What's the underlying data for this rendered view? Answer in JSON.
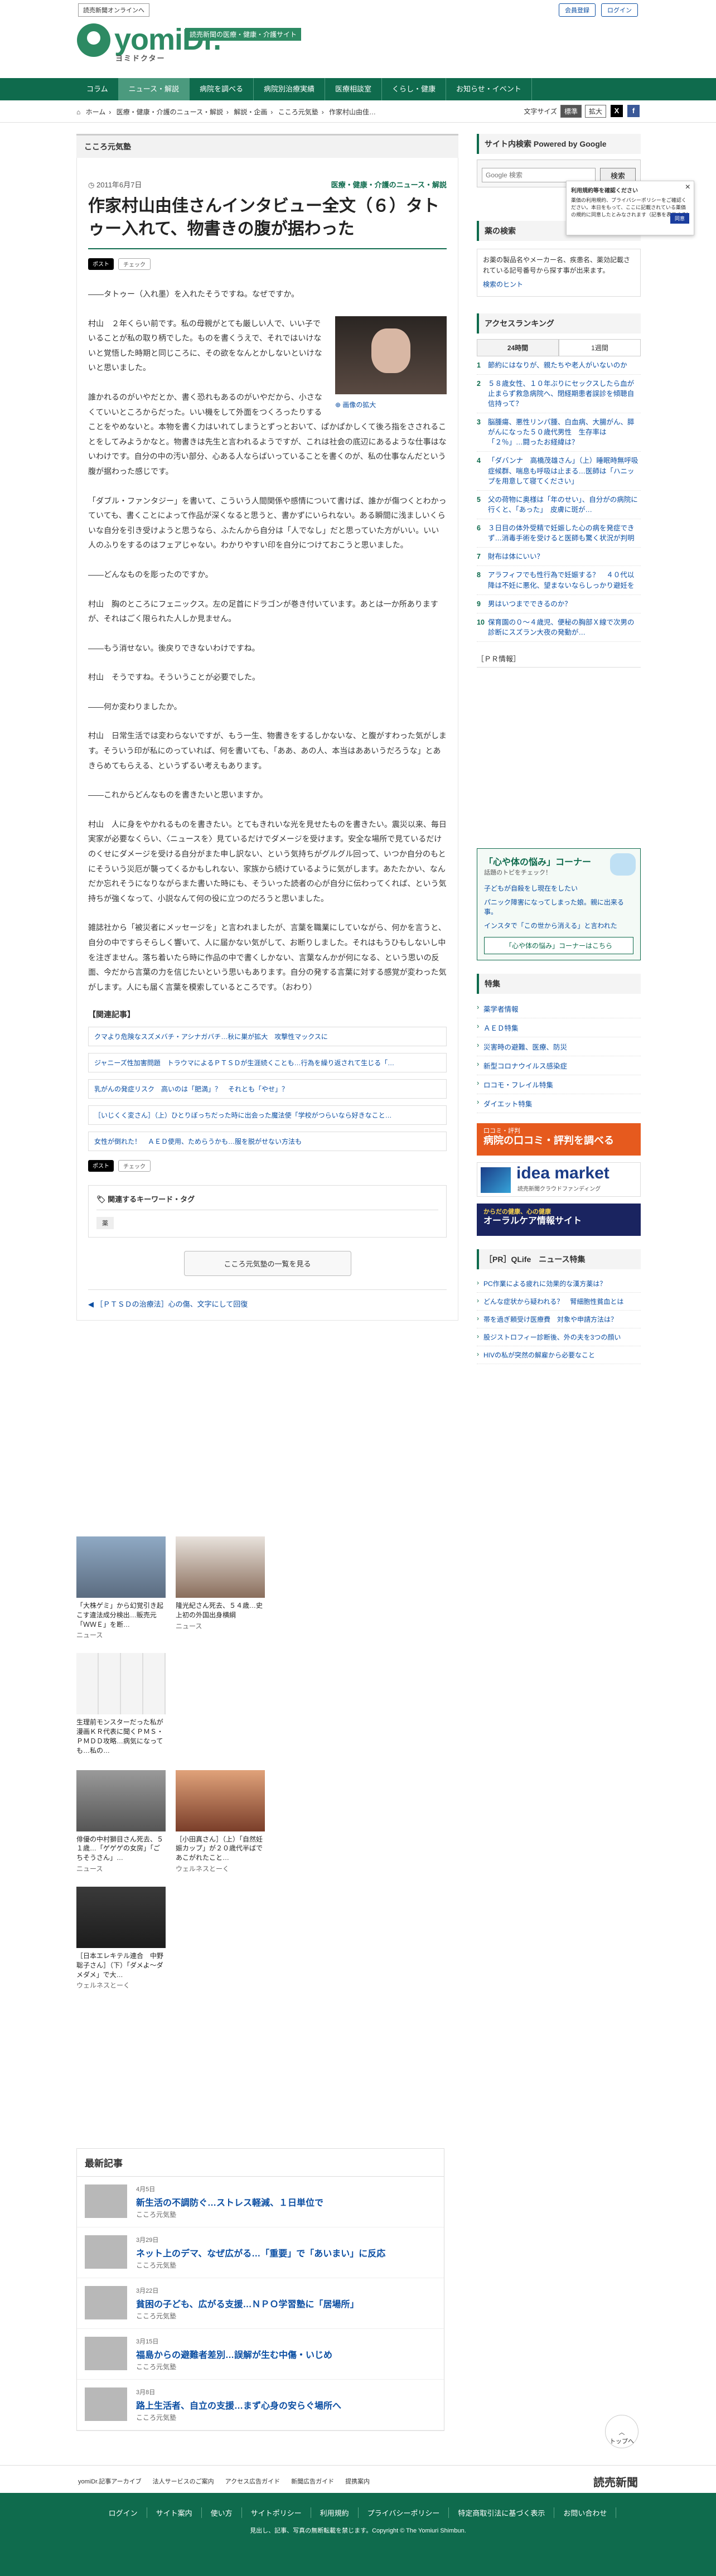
{
  "topbar": {
    "yol": "読売新聞オンラインへ",
    "member": "会員登録",
    "login": "ログイン"
  },
  "logo": {
    "name": "yomiDr.",
    "kana": "ヨミドクター",
    "tag": "読売新聞の医療・健康・介護サイト"
  },
  "gnav": [
    "コラム",
    "ニュース・解説",
    "病院を調べる",
    "病院別治療実績",
    "医療相談室",
    "くらし・健康",
    "お知らせ・イベント"
  ],
  "gnav_active": "ニュース・解説",
  "breadcrumbs": [
    "ホーム",
    "医療・健康・介護のニュース・解説",
    "解説・企画",
    "こころ元気塾",
    "作家村山由佳…"
  ],
  "fontsize": {
    "label": "文字サイズ",
    "std": "標準",
    "big": "拡大"
  },
  "article": {
    "section": "こころ元気塾",
    "date": "2011年6月7日",
    "category": "医療・健康・介護のニュース・解説",
    "title": "作家村山由佳さんインタビュー全文（６）タトゥー入れて、物書きの腹が据わった",
    "share_x": "ポスト",
    "share_check": "チェック",
    "photo_caption": "画像の拡大",
    "paragraphs": [
      "――タトゥー（入れ墨）を入れたそうですね。なぜですか。",
      "村山　２年くらい前です。私の母親がとても厳しい人で、いい子でいることが私の取り柄でした。ものを書くうえで、それではいけないと覚悟した時期と同じころに、その欲をなんとかしないといけないと思いました。",
      "誰かれるのがいやだとか、書く恐れもあるのがいやだから、小さなくていいところからだった。いい機をして外面をつくろったりすることをやめないと。本物を書く力はいれてしまうとずっとおいて、ぱかぱかしくて後ろ指をさされることをしてみようかなと。物書きは先生と言われるようですが、これは社会の底辺にあるような仕事はないわけです。自分の中の汚い部分、心ある人ならばいっていることを書くのが、私の仕事なんだという腹が据わった感じです。",
      "「ダブル・ファンタジー」を書いて、こういう人間関係や感情について書けば、誰かが傷つくとわかっていても、書くことによって作品が深くなると思うと、書かずにいられない。ある瞬間に浅ましいくらいな自分を引き受けようと思うなら、ふたんから自分は「人でなし」だと思っていた方がいい。いい人のふりをするのはフェアじゃない。わかりやすい印を自分につけておこうと思いました。",
      "――どんなものを彫ったのですか。",
      "村山　胸のところにフェニックス。左の足首にドラゴンが巻き付いています。あとは一か所ありますが、それはごく限られた人しか見ません。",
      "――もう消せない。後戻りできないわけですね。",
      "村山　そうですね。そういうことが必要でした。",
      "――何か変わりましたか。",
      "村山　日常生活では変わらないですが、もう一生、物書きをするしかないな、と腹がすわった気がします。そういう印が私にのっていれば、何を書いても、「ああ、あの人、本当はああいうだろうな」とあきらめてもらえる、というずるい考えもあります。",
      "――これからどんなものを書きたいと思いますか。",
      "村山　人に身をやかれるものを書きたい。とてもきれいな光を見せたものを書きたい。震災以来、毎日実家が必要なくらい、〈ニュースを〉見ているだけでダメージを受けます。安全な場所で見ているだけのくせにダメージを受ける自分がまた申し訳ない、という気持ちがグルグル回って、いつか自分のもとにそういう災厄が襲ってくるかもしれない、家族から続けているように気がします。あたたかい、なんだか忘れそうになりながらまた書いた時にも、そういった読者の心が自分に伝わってくれば、という気持ちが強くなって、小説なんて何の役に立つのだろうと思いました。",
      "雑誌社から「被災者にメッセージを」と言われましたが、言葉を職業にしていながら、何かを言うと、自分の中ですらそらしく響いて、人に届かない気がして、お断りしました。それはもうひもしないし中を注ぎません。落ち着いたら時に作品の中で書くしかない、言葉なんかが何になる、という思いの反面、今だから言葉の力を信じたいという思いもあります。自分の発する言葉に対する感覚が変わった気がします。人にも届く言葉を模索しているところです。（おわり）"
    ]
  },
  "related": {
    "heading": "【関連記事】",
    "items": [
      "クマより危険なスズメバチ・アシナガバチ…秋に巣が拡大　攻撃性マックスに",
      "ジャニーズ性加害問題　トラウマによるＰＴＳＤが生涯続くことも…行為を繰り返されて生じる「…",
      "乳がんの発症リスク　高いのは「肥満」？　それとも「やせ」？",
      "［いじくく変さん］（上）ひとりぼっちだった時に出会った魔法使「学校がつらいなら好きなこと…",
      "女性が倒れた！　ＡＥＤ使用、ためらうかも…服を脱がせない方法も"
    ]
  },
  "keywords": {
    "heading": "関連するキーワード・タグ",
    "tags": [
      "薬"
    ]
  },
  "more_button": "こころ元気塾の一覧を見る",
  "prev_link": "［ＰＴＳＤの治療法］心の傷、文字にして回復",
  "sidebar": {
    "search_heading": "サイト内検索 Powered by Google",
    "search_placeholder": "Google 検索",
    "search_button": "検索",
    "popup_title": "利用規約等を確認ください",
    "popup_body": "薬価の利用規約、プライバシーポリシーをご確認ください。本日をもって、ここに記載されている薬価の規約に同意したとみなされます（記事を表示する）",
    "popup_ok": "同意",
    "intro_heading": "薬の検索",
    "intro_text": "お薬の製品名やメーカー名、疾患名、薬効記載されている記号番号から探す事が出来ます。",
    "intro_link": "検索のヒント",
    "ranking_heading": "アクセスランキング",
    "ranking_tabs": [
      "24時間",
      "1週間"
    ],
    "ranking": [
      "節約にはなりが、親たちや老人がいないのか",
      "５８歳女性、１０年ぶりにセックスしたら血が止まらず救急病院へ、閉経期患者誤診を傾聴自信持って？",
      "脳腫瘍、悪性リンパ腫、白血病、大腸がん、膵がんになった５０歳代男性　生存率は「２％」…闘ったお経緯は？",
      "「ダバンナ　高橋茂雄さん」（上）睡眠時無呼吸症候群、喘息も呼吸は止まる…医師は「ハニップを用意して寝てください」",
      "父の荷物に奥様は「年のせい」、自分がの病院に行くと、「あった」　皮膚に斑が…",
      "３日目の体外受精で妊娠した心の病を発症できず…消毒手術を受けると医師も驚く状況が判明",
      "財布は体にいい？",
      "アラフィフでも性行為で妊娠する？　４０代以降は不妊に悪化、望まないならしっかり避妊を",
      "男はいつまでできるのか？",
      "保育園の０～４歳児、便秘の胸部Ｘ線で次男の診断にスズラン大夜の発動が…"
    ],
    "pr_heading": "［ＰＲ情報］",
    "kokoro_title": "「心や体の悩み」コーナー",
    "kokoro_sub": "話題のトピをチェック！",
    "kokoro_items": [
      "子どもが自殺をし現在をしたい",
      "パニック障害になってしまった娘。親に出来る事。",
      "インスタで「この世から消える」と言われた"
    ],
    "kokoro_cta": "「心や体の悩み」コーナーはこちら",
    "tokushu_heading": "特集",
    "tokushu": [
      "薬学者情報",
      "ＡＥＤ特集",
      "災害時の避難、医療、防災",
      "新型コロナウイルス感染症",
      "ロコモ・フレイル特集",
      "ダイエット特集"
    ],
    "banner1_small": "口コミ・評判",
    "banner1": "病院の口コミ・評判を調べる",
    "banner2": "idea market",
    "banner2_sub": "読売新聞クラウドファンディング",
    "banner3_small": "からだの健康、心の健康",
    "banner3": "オーラルケア情報サイト",
    "qlife_heading": "［PR］QLife　ニュース特集",
    "qlife": [
      "PC作業による疲れに効果的な漢方薬は？",
      "どんな症状から疑われる？　腎細胞性貧血とは",
      "帯を過ぎ頼受け医療費　対象や申請方法は？",
      "股ジストロフィー診断後、外の夫を3つの顔い",
      "HIVの私が突然の解雇から必要なこと"
    ]
  },
  "cards": [
    {
      "title": "「大株ゲミ」から幻覚引き起こす違法成分検出…販売元「ＷＷＥ」を断…",
      "src": "ニュース"
    },
    {
      "title": "隆光紀さん死去、５４歳…史上初の外国出身横綱",
      "src": "ニュース"
    },
    {
      "title": "生理前モンスターだった私が漫画ＫＲ代表に聞くＰＭＳ・ＰＭＤＤ攻略…病気になっても…私の…",
      "src": ""
    },
    {
      "title": "俳優の中村獅目さん死去、５１歳…「ゲゲゲの女房」「ごちそうさん」…",
      "src": "ニュース"
    },
    {
      "title": "［小田真さん］（上）「自然妊娠カップ」が２０歳代半ばであこがれたこと…",
      "src": "ウェルネスとーく"
    },
    {
      "title": "［日本エレキテル連合　中野聡子さん］（下）「ダメよ～ダメダメ」で大…",
      "src": "ウェルネスとーく"
    }
  ],
  "latest": {
    "heading": "最新記事",
    "items": [
      {
        "date": "4月5日",
        "title": "新生活の不調防ぐ…ストレス軽減、１日単位で",
        "cat": "こころ元気塾"
      },
      {
        "date": "3月29日",
        "title": "ネット上のデマ、なぜ広がる…「重要」で「あいまい」に反応",
        "cat": "こころ元気塾"
      },
      {
        "date": "3月22日",
        "title": "貧困の子ども、広がる支援…ＮＰＯ学習塾に「居場所」",
        "cat": "こころ元気塾"
      },
      {
        "date": "3月15日",
        "title": "福島からの避難者差別…誤解が生む中傷・いじめ",
        "cat": "こころ元気塾"
      },
      {
        "date": "3月8日",
        "title": "路上生活者、自立の支援…まず心身の安らぐ場所へ",
        "cat": "こころ元気塾"
      }
    ]
  },
  "totop": "トップへ",
  "footer": {
    "links1": [
      "yomiDr.記事アーカイブ",
      "法人サービスのご案内",
      "アクセス広告ガイド",
      "新聞広告ガイド",
      "提携案内"
    ],
    "yomiuri": "読売新聞",
    "links2": [
      "ログイン",
      "サイト案内",
      "使い方",
      "サイトポリシー",
      "利用規約",
      "プライバシーポリシー",
      "特定商取引法に基づく表示",
      "お問い合わせ"
    ],
    "copy": "見出し、記事、写真の無断転載を禁じます。Copyright © The Yomiuri Shimbun."
  }
}
